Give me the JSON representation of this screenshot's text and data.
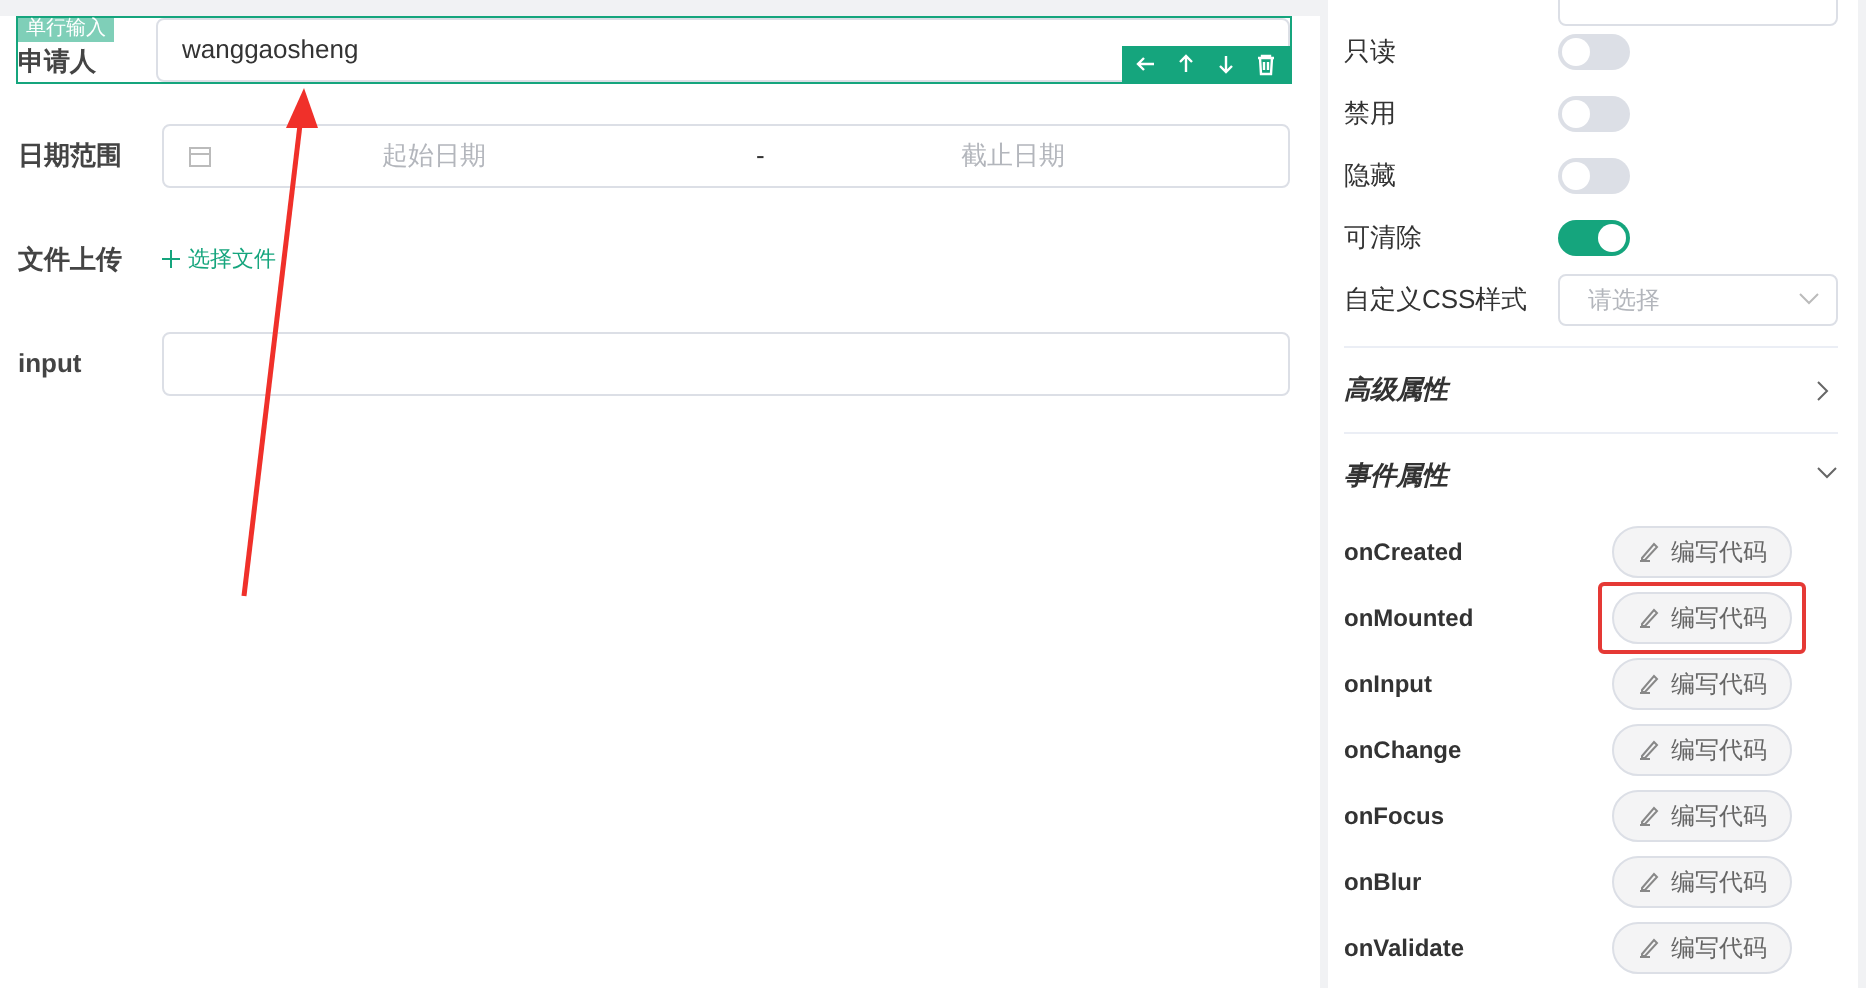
{
  "form": {
    "selected_badge": "单行输入",
    "fields": [
      {
        "kind": "text",
        "label": "申请人",
        "value": "wanggaosheng",
        "selected": true
      },
      {
        "kind": "daterange",
        "label": "日期范围",
        "start_placeholder": "起始日期",
        "separator": "-",
        "end_placeholder": "截止日期",
        "selected": false
      },
      {
        "kind": "upload",
        "label": "文件上传",
        "button": "选择文件",
        "selected": false
      },
      {
        "kind": "text",
        "label": "input",
        "selected": false
      }
    ]
  },
  "properties": {
    "toggles": [
      {
        "label": "只读",
        "on": false
      },
      {
        "label": "禁用",
        "on": false
      },
      {
        "label": "隐藏",
        "on": false
      },
      {
        "label": "可清除",
        "on": true
      }
    ],
    "css_select": {
      "label": "自定义CSS样式",
      "placeholder": "请选择"
    },
    "sections": [
      {
        "title": "高级属性",
        "expanded": false
      },
      {
        "title": "事件属性",
        "expanded": true
      }
    ],
    "events": [
      {
        "name": "onCreated",
        "button": "编写代码",
        "highlighted": false
      },
      {
        "name": "onMounted",
        "button": "编写代码",
        "highlighted": true
      },
      {
        "name": "onInput",
        "button": "编写代码",
        "highlighted": false
      },
      {
        "name": "onChange",
        "button": "编写代码",
        "highlighted": false
      },
      {
        "name": "onFocus",
        "button": "编写代码",
        "highlighted": false
      },
      {
        "name": "onBlur",
        "button": "编写代码",
        "highlighted": false
      },
      {
        "name": "onValidate",
        "button": "编写代码",
        "highlighted": false
      }
    ]
  }
}
